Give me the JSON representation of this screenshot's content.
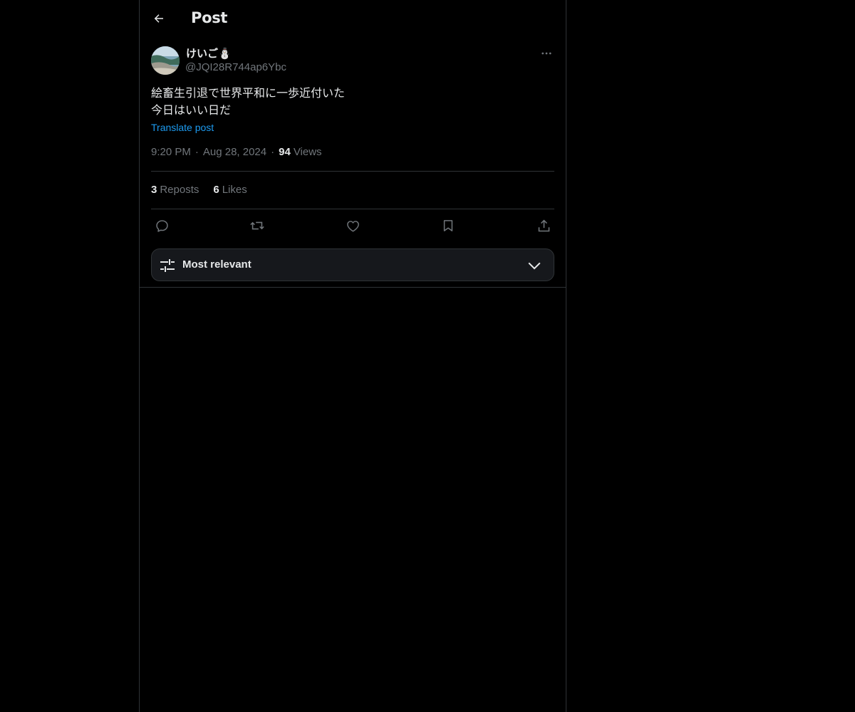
{
  "header": {
    "title": "Post"
  },
  "author": {
    "display_name": "けいご⛄",
    "handle": "@JQI28R744ap6Ybc"
  },
  "post": {
    "lines": [
      "絵畜生引退で世界平和に一歩近付いた",
      "今日はいい日だ"
    ],
    "translate_label": "Translate post",
    "time": "9:20 PM",
    "date": "Aug 28, 2024",
    "views_count": "94",
    "views_label": "Views"
  },
  "stats": {
    "reposts_count": "3",
    "reposts_label": "Reposts",
    "likes_count": "6",
    "likes_label": "Likes"
  },
  "actions": {
    "icons": [
      "reply-icon",
      "repost-icon",
      "like-icon",
      "bookmark-icon",
      "share-icon"
    ]
  },
  "sort": {
    "label": "Most relevant"
  },
  "colors": {
    "background": "#000000",
    "text": "#e7e9ea",
    "muted": "#71767b",
    "accent": "#1d9bf0",
    "border": "#2f3336"
  }
}
